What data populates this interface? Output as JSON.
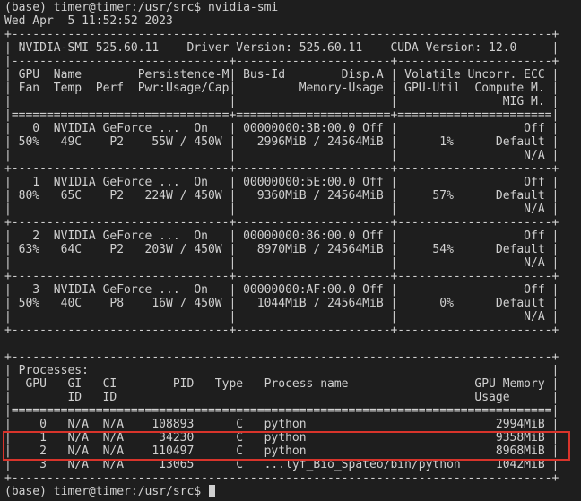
{
  "terminal": {
    "background": "#1e1e1e",
    "foreground": "#d0d0d0",
    "highlight_color": "#d9342b",
    "lines": [
      "(base) timer@timer:/usr/src$ nvidia-smi",
      "Wed Apr  5 11:52:52 2023",
      "+-----------------------------------------------------------------------------+",
      "| NVIDIA-SMI 525.60.11    Driver Version: 525.60.11    CUDA Version: 12.0     |",
      "|-------------------------------+----------------------+----------------------+",
      "| GPU  Name        Persistence-M| Bus-Id        Disp.A | Volatile Uncorr. ECC |",
      "| Fan  Temp  Perf  Pwr:Usage/Cap|         Memory-Usage | GPU-Util  Compute M. |",
      "|                               |                      |               MIG M. |",
      "|===============================+======================+======================|",
      "|   0  NVIDIA GeForce ...  On   | 00000000:3B:00.0 Off |                  Off |",
      "| 50%   49C    P2    55W / 450W |   2996MiB / 24564MiB |      1%      Default |",
      "|                               |                      |                  N/A |",
      "+-------------------------------+----------------------+----------------------+",
      "|   1  NVIDIA GeForce ...  On   | 00000000:5E:00.0 Off |                  Off |",
      "| 80%   65C    P2   224W / 450W |   9360MiB / 24564MiB |     57%      Default |",
      "|                               |                      |                  N/A |",
      "+-------------------------------+----------------------+----------------------+",
      "|   2  NVIDIA GeForce ...  On   | 00000000:86:00.0 Off |                  Off |",
      "| 63%   64C    P2   203W / 450W |   8970MiB / 24564MiB |     54%      Default |",
      "|                               |                      |                  N/A |",
      "+-------------------------------+----------------------+----------------------+",
      "|   3  NVIDIA GeForce ...  On   | 00000000:AF:00.0 Off |                  Off |",
      "| 50%   40C    P8    16W / 450W |   1044MiB / 24564MiB |      0%      Default |",
      "|                               |                      |                  N/A |",
      "+-------------------------------+----------------------+----------------------+",
      "",
      "+-----------------------------------------------------------------------------+",
      "| Processes:                                                                  |",
      "|  GPU   GI   CI        PID   Type   Process name                  GPU Memory |",
      "|        ID   ID                                                   Usage      |",
      "|=============================================================================|",
      "|    0   N/A  N/A    108893      C   python                           2994MiB |",
      "|    1   N/A  N/A     34230      C   python                           9358MiB |",
      "|    2   N/A  N/A    110497      C   python                           8968MiB |",
      "|    3   N/A  N/A     13065      C   ...lyf_Bio_Spateo/bin/python     1042MiB |",
      "+-----------------------------------------------------------------------------+",
      "(base) timer@timer:/usr/src$ "
    ]
  }
}
